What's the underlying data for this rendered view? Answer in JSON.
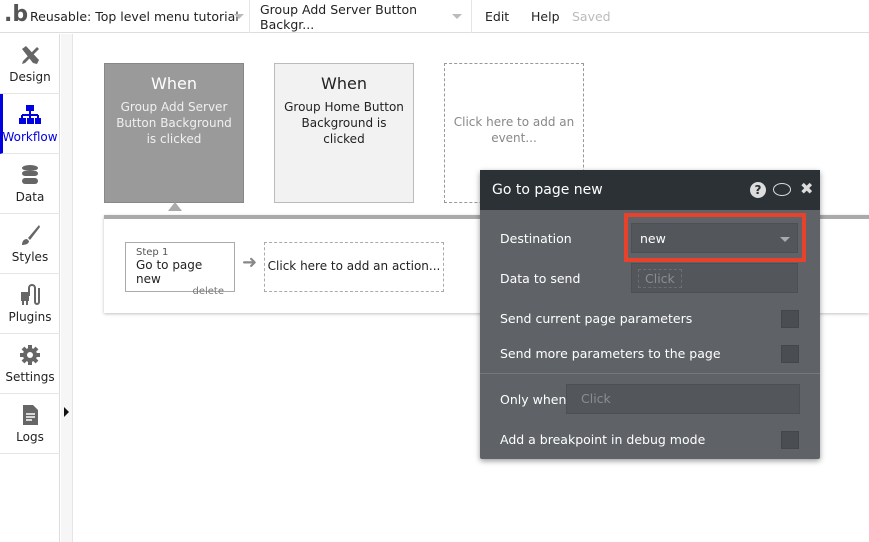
{
  "topbar": {
    "logo": ".b",
    "page_select": "Reusable: Top level menu tutorial",
    "element_select": "Group Add Server Button Backgr...",
    "menu_edit": "Edit",
    "menu_help": "Help",
    "status": "Saved"
  },
  "sidebar": {
    "items": [
      {
        "label": "Design",
        "icon": "design-icon"
      },
      {
        "label": "Workflow",
        "icon": "workflow-icon",
        "active": true
      },
      {
        "label": "Data",
        "icon": "database-icon"
      },
      {
        "label": "Styles",
        "icon": "brush-icon"
      },
      {
        "label": "Plugins",
        "icon": "plug-icon"
      },
      {
        "label": "Settings",
        "icon": "gear-icon"
      },
      {
        "label": "Logs",
        "icon": "document-icon"
      }
    ]
  },
  "events": [
    {
      "title": "When",
      "desc": "Group Add Server Button Background is clicked",
      "selected": true
    },
    {
      "title": "When",
      "desc": "Group Home Button Background is clicked"
    },
    {
      "add": "Click here to add an event..."
    }
  ],
  "actions": {
    "step_num": "Step 1",
    "step_title": "Go to page new",
    "step_delete": "delete",
    "add_action": "Click here to add an action..."
  },
  "popup": {
    "title": "Go to page new",
    "destination_label": "Destination",
    "destination_value": "new",
    "data_label": "Data to send",
    "data_placeholder": "Click",
    "send_current_label": "Send current page parameters",
    "send_current_checked": false,
    "send_more_label": "Send more parameters to the page",
    "send_more_checked": false,
    "only_when_label": "Only when",
    "only_when_placeholder": "Click",
    "breakpoint_label": "Add a breakpoint in debug mode",
    "breakpoint_checked": false,
    "highlight_color": "#e8412c"
  }
}
